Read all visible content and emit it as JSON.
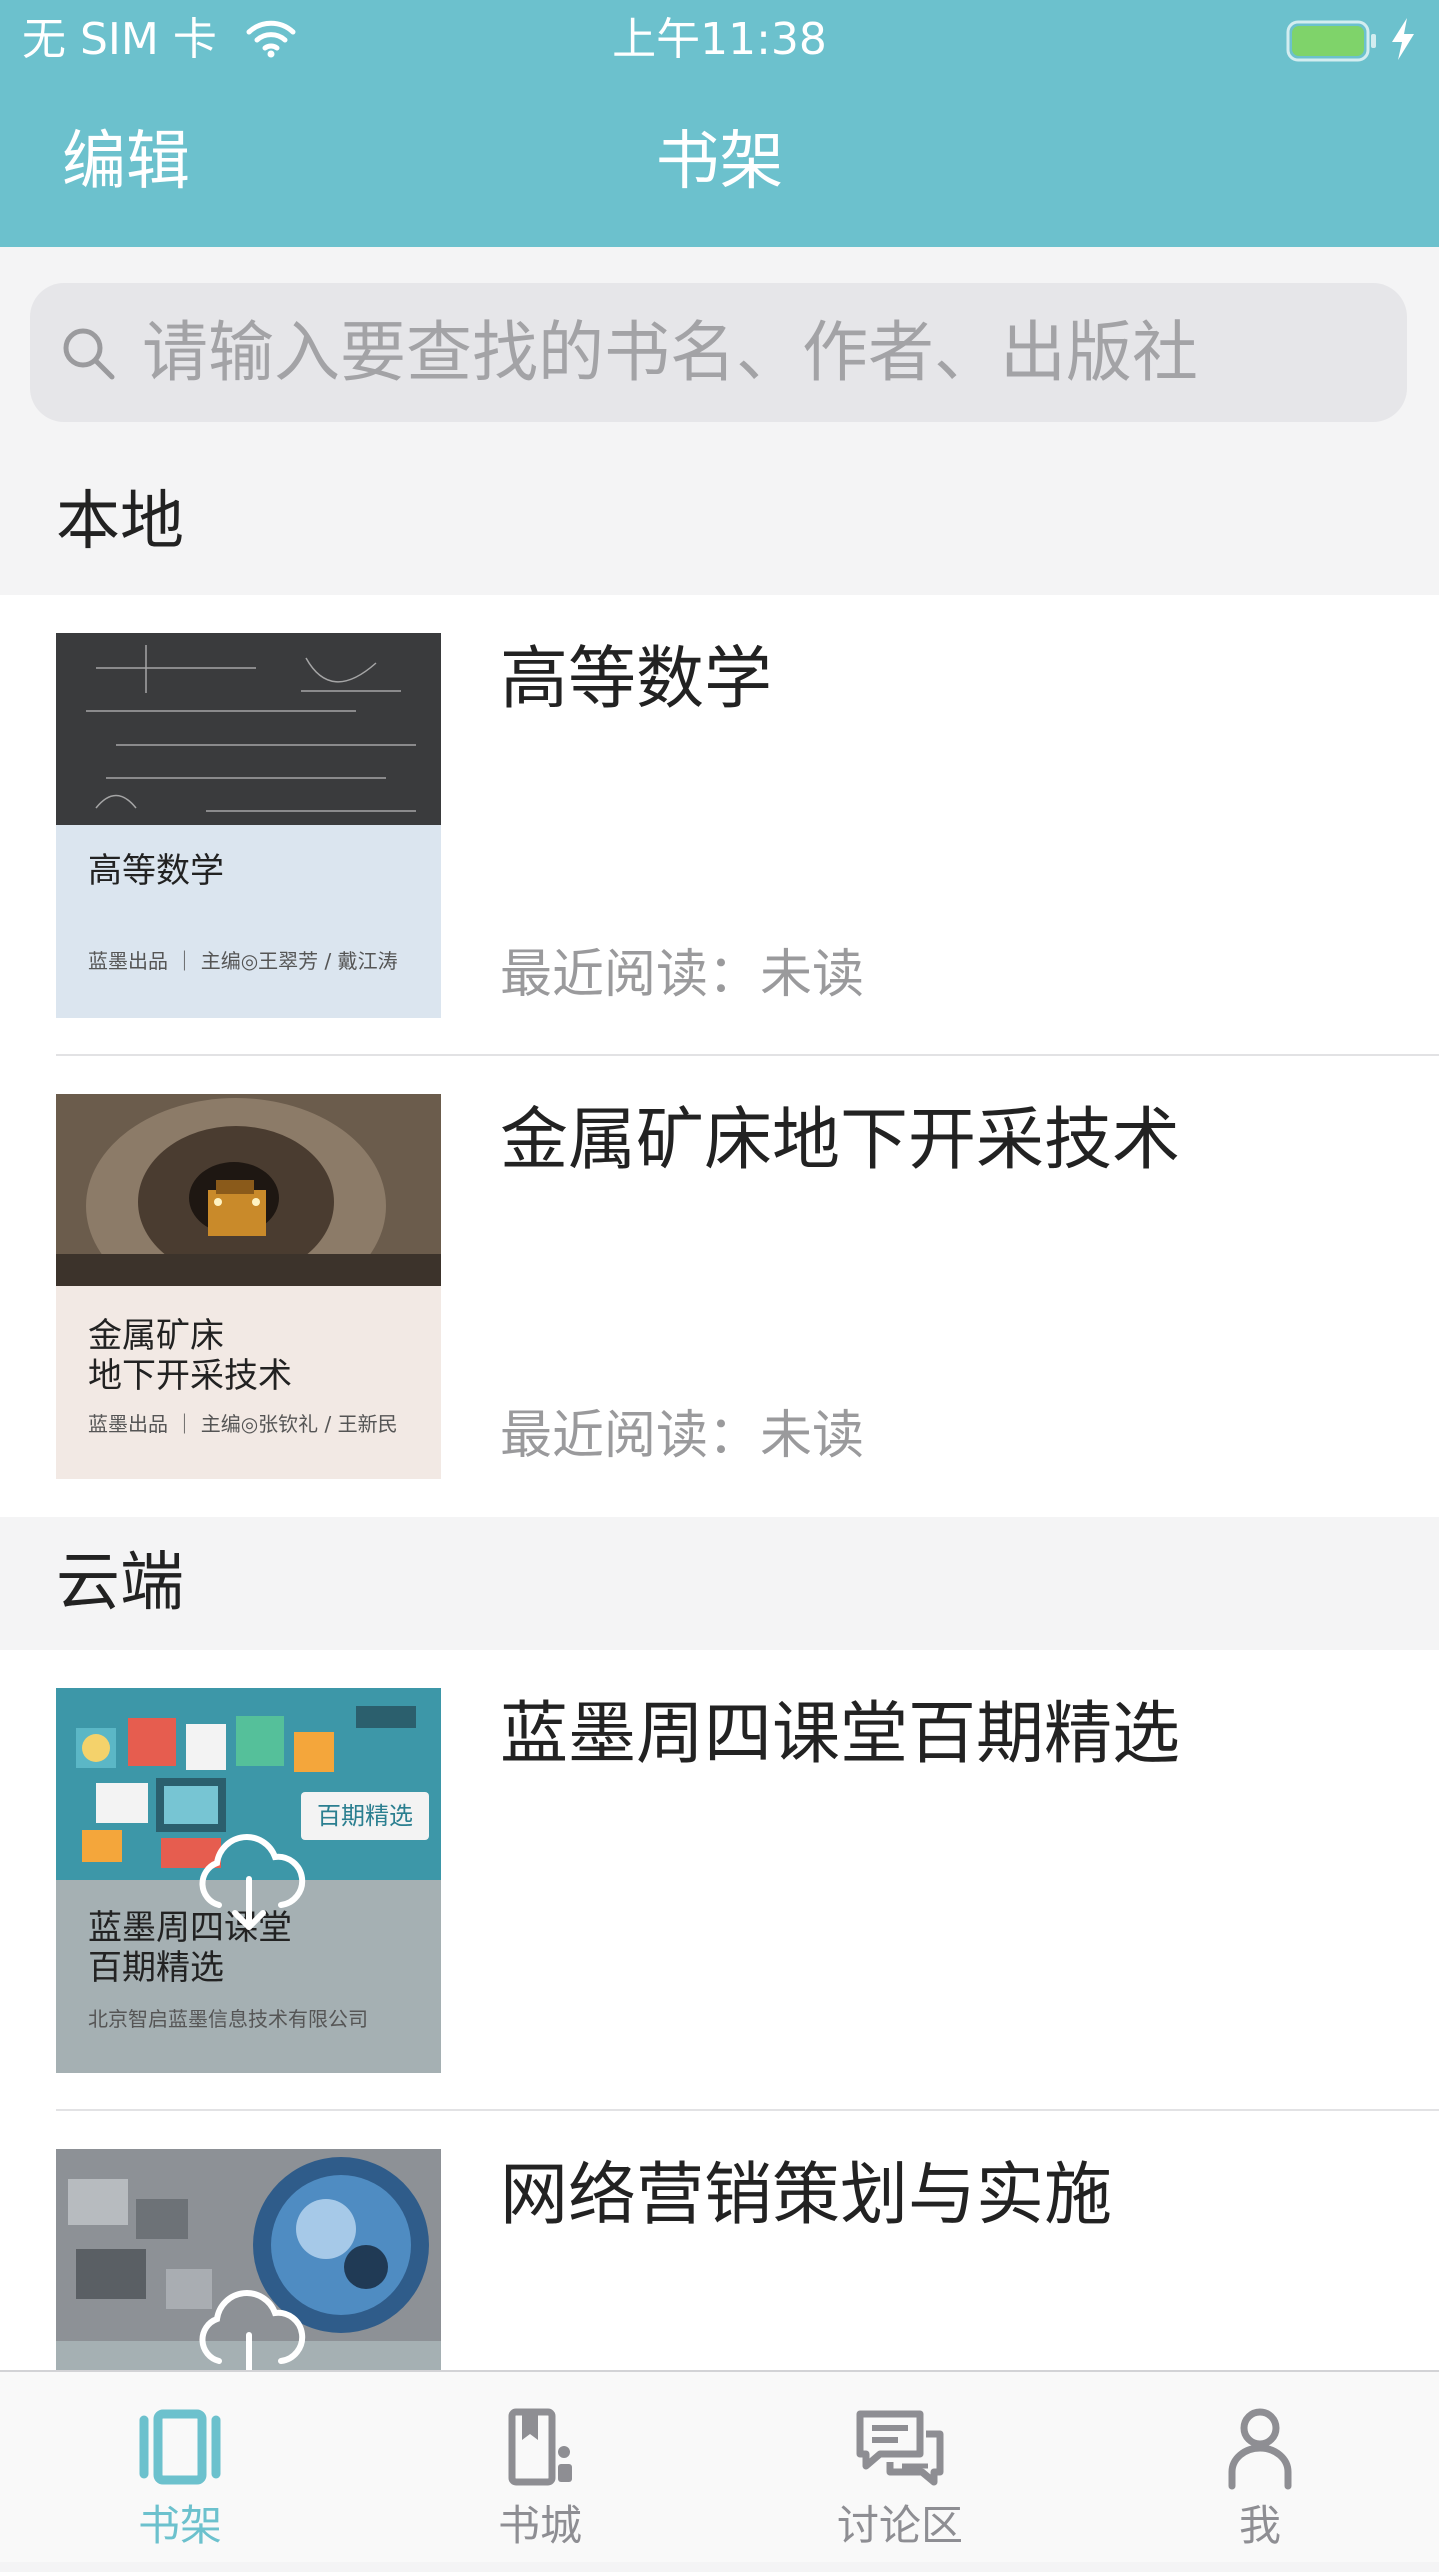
{
  "status_bar": {
    "carrier": "无 SIM 卡",
    "time": "上午11:38"
  },
  "nav": {
    "edit_label": "编辑",
    "title": "书架"
  },
  "search": {
    "placeholder": "请输入要查找的书名、作者、出版社"
  },
  "colors": {
    "accent": "#6cc1cd",
    "inactive": "#8e8e93",
    "battery": "#7fd36a"
  },
  "sections": [
    {
      "title": "本地",
      "books": [
        {
          "title": "高等数学",
          "recent": "最近阅读：未读",
          "cover": {
            "title": "高等数学",
            "credit": "蓝墨出品 ｜ 主编◎王翠芳 / 戴江涛"
          }
        },
        {
          "title": "金属矿床地下开采技术",
          "recent": "最近阅读：未读",
          "cover": {
            "title": "金属矿床\n地下开采技术",
            "credit": "蓝墨出品 ｜ 主编◎张钦礼 / 王新民"
          }
        }
      ]
    },
    {
      "title": "云端",
      "books": [
        {
          "title": "蓝墨周四课堂百期精选",
          "cover": {
            "title": "蓝墨周四课堂\n百期精选",
            "credit": "北京智启蓝墨信息技术有限公司",
            "badge": "百期精选"
          },
          "icon": "cloud-download-icon"
        },
        {
          "title": "网络营销策划与实施",
          "icon": "cloud-download-icon"
        }
      ]
    }
  ],
  "tabs": [
    {
      "label": "书架",
      "icon": "bookshelf-icon",
      "active": true
    },
    {
      "label": "书城",
      "icon": "bookstore-icon",
      "active": false
    },
    {
      "label": "讨论区",
      "icon": "discussion-icon",
      "active": false
    },
    {
      "label": "我",
      "icon": "person-icon",
      "active": false
    }
  ]
}
